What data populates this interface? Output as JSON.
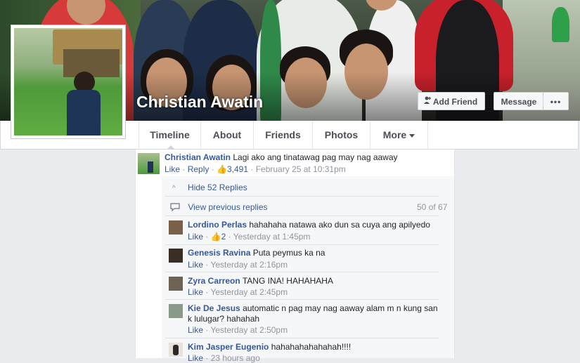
{
  "profile": {
    "name": "Christian Awatin",
    "add_friend_label": "Add Friend",
    "message_label": "Message",
    "more_dots": "•••"
  },
  "tabs": [
    {
      "label": "Timeline"
    },
    {
      "label": "About"
    },
    {
      "label": "Friends"
    },
    {
      "label": "Photos"
    },
    {
      "label": "More"
    }
  ],
  "top_comment": {
    "author": "Christian Awatin",
    "text": "Lagi ako ang tinatawag pag may nag aaway",
    "like": "Like",
    "reply": "Reply",
    "sep": " · ",
    "likes_count": "3,491",
    "time": "February 25 at 10:31pm"
  },
  "replies_bar": {
    "hide_label": "Hide 52 Replies",
    "view_prev_label": "View previous replies",
    "count_label": "50 of 67"
  },
  "replies": [
    {
      "author": "Lordino Perlas",
      "text": "hahahaha natawa ako dun sa cuya ang apilyedo",
      "like": "Like",
      "likes": "2",
      "time": "Yesterday at 1:45pm"
    },
    {
      "author": "Genesis Ravina",
      "text": "Puta peymus ka na",
      "like": "Like",
      "time": "Yesterday at 2:16pm"
    },
    {
      "author": "Zyra Carreon",
      "text": "TANG INA! HAHAHAHA",
      "like": "Like",
      "time": "Yesterday at 2:45pm"
    },
    {
      "author": "Kie De Jesus",
      "text": "automatic n pag may nag aaway alam m n kung san",
      "text2": "k lulugar? hahahah",
      "like": "Like",
      "time": "Yesterday at 2:50pm"
    },
    {
      "author": "Kim Jasper Eugenio",
      "text": "hahahahahahahah!!!!",
      "like": "Like",
      "time": "23 hours ago"
    }
  ],
  "colors": {
    "link": "#365899",
    "meta": "#90949c",
    "background": "#e9ebee"
  },
  "icons": {
    "like": "thumbs-up-icon",
    "chevron": "chevron-up-icon",
    "comment": "comment-bubble-icon",
    "add_friend": "add-friend-icon"
  }
}
